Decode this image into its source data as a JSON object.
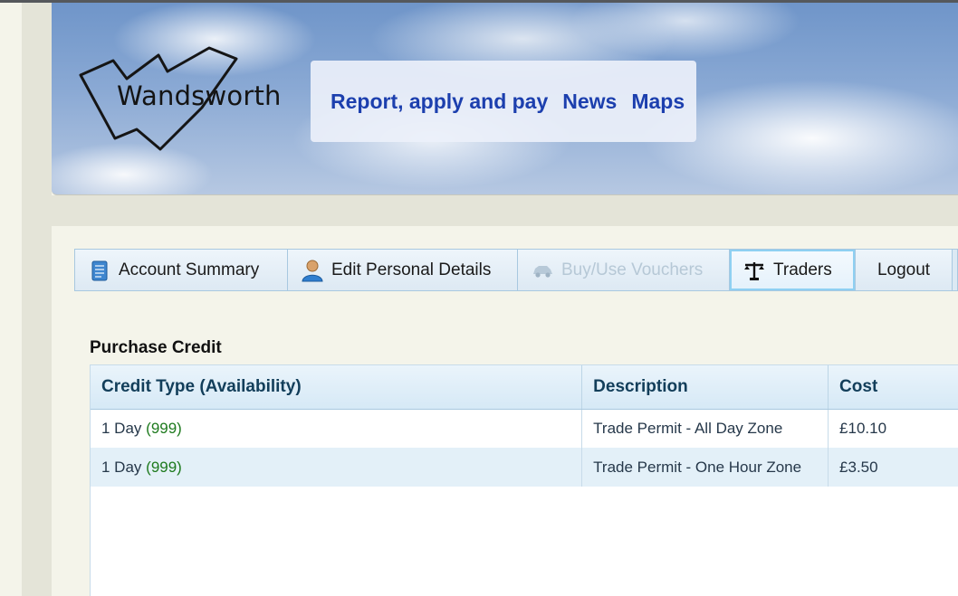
{
  "header": {
    "logo_text": "Wandsworth",
    "nav_links": [
      "Report, apply and pay",
      "News",
      "Maps"
    ]
  },
  "tabs": [
    {
      "label": "Account Summary",
      "icon": "scroll-icon",
      "state": "normal"
    },
    {
      "label": "Edit Personal Details",
      "icon": "person-icon",
      "state": "normal"
    },
    {
      "label": "Buy/Use Vouchers",
      "icon": "car-icon",
      "state": "disabled"
    },
    {
      "label": "Traders",
      "icon": "scales-icon",
      "state": "active"
    },
    {
      "label": "Logout",
      "icon": "",
      "state": "normal"
    }
  ],
  "purchase": {
    "title": "Purchase Credit",
    "columns": [
      "Credit Type (Availability)",
      "Description",
      "Cost"
    ],
    "rows": [
      {
        "type": "1 Day",
        "availability": "(999)",
        "description": "Trade Permit - All Day Zone",
        "cost": "£10.10"
      },
      {
        "type": "1 Day",
        "availability": "(999)",
        "description": "Trade Permit - One Hour Zone",
        "cost": "£3.50"
      }
    ]
  },
  "colors": {
    "nav_link": "#1c3fae",
    "availability": "#1e7a1e",
    "header_text": "#123e5a",
    "active_tab_glow": "#8fd0f2"
  }
}
